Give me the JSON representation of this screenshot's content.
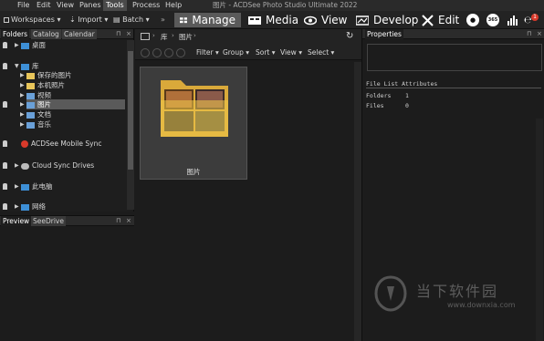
{
  "menu": [
    "File",
    "Edit",
    "View",
    "Panes",
    "Tools",
    "Process",
    "Help"
  ],
  "menu_active": "Tools",
  "window_title": "图片 - ACDSee Photo Studio Ultimate 2022",
  "toolbar": {
    "workspaces": "Workspaces",
    "import": "Import",
    "batch": "Batch",
    "modes": [
      "Manage",
      "Media",
      "View",
      "Develop",
      "Edit"
    ],
    "active_mode": "Manage",
    "badge_count": "1"
  },
  "folders_panel": {
    "tabs": [
      "Folders",
      "Catalog",
      "Calendar"
    ],
    "tree": [
      {
        "label": "桌面"
      },
      {
        "label": "库"
      },
      {
        "label": "保存的图片"
      },
      {
        "label": "本机照片"
      },
      {
        "label": "视频"
      },
      {
        "label": "图片"
      },
      {
        "label": "文档"
      },
      {
        "label": "音乐"
      },
      {
        "label": "ACDSee Mobile Sync"
      },
      {
        "label": "Cloud Sync Drives"
      },
      {
        "label": "此电脑"
      },
      {
        "label": "网络"
      }
    ]
  },
  "preview_panel": {
    "tabs": [
      "Preview",
      "SeeDrive"
    ]
  },
  "main": {
    "breadcrumb": [
      "库",
      "图片"
    ],
    "filter_bar": [
      "Filter",
      "Group",
      "Sort",
      "View",
      "Select"
    ],
    "thumbnail_label": "图片"
  },
  "properties": {
    "title": "Properties",
    "section": "File List Attributes",
    "rows": [
      {
        "key": "Folders",
        "value": "1"
      },
      {
        "key": "Files",
        "value": "0"
      }
    ]
  },
  "watermark": {
    "brand": "当下软件园",
    "url": "www.downxia.com"
  },
  "colors": {
    "accent_red": "#d93a2b",
    "folder_yellow": "#f0c94a",
    "selection": "#5a5a5a"
  }
}
